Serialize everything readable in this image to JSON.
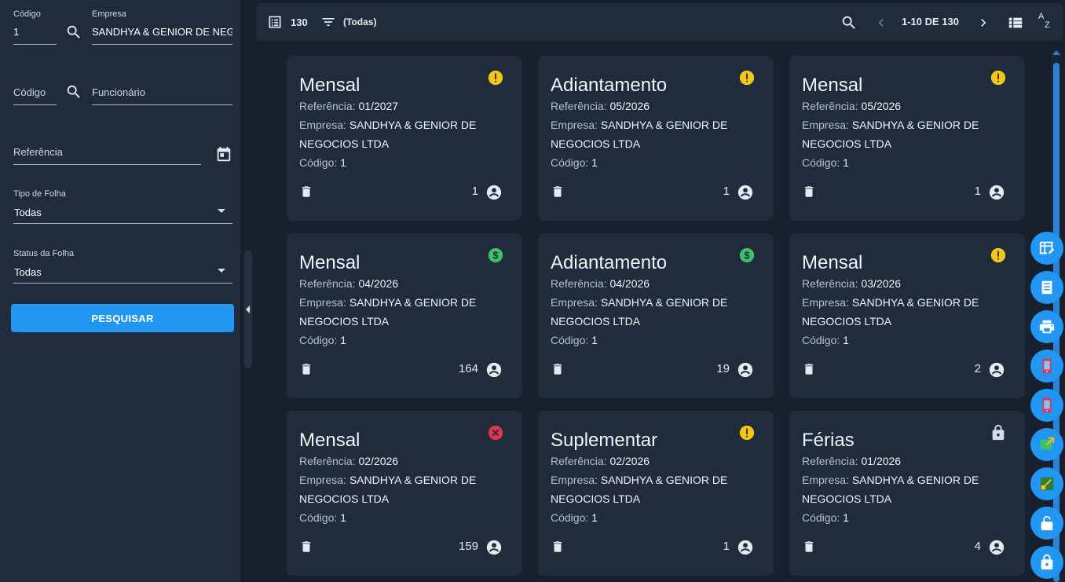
{
  "filters": {
    "codigo_label": "Código",
    "codigo_value": "1",
    "empresa_label": "Empresa",
    "empresa_value": "SANDHYA & GENIOR DE NEGO",
    "func_codigo_placeholder": "Código",
    "funcionario_placeholder": "Funcionário",
    "referencia_placeholder": "Referência",
    "tipo_label": "Tipo de Folha",
    "tipo_value": "Todas",
    "status_label": "Status da Folha",
    "status_value": "Todas",
    "search_button": "PESQUISAR"
  },
  "toolbar": {
    "count": "130",
    "filter_label": "(Todas)",
    "pagination": "1-10 DE 130"
  },
  "labels": {
    "referencia": "Referência:",
    "empresa": "Empresa:",
    "codigo": "Código:"
  },
  "cards": [
    {
      "title": "Mensal",
      "referencia": "01/2027",
      "empresa_l1": "SANDHYA & GENIOR DE",
      "empresa_l2": "NEGOCIOS LTDA",
      "codigo": "1",
      "count": "1",
      "status": "warning-icon"
    },
    {
      "title": "Adiantamento",
      "referencia": "05/2026",
      "empresa_l1": "SANDHYA & GENIOR DE",
      "empresa_l2": "NEGOCIOS LTDA",
      "codigo": "1",
      "count": "1",
      "status": "warning-icon"
    },
    {
      "title": "Mensal",
      "referencia": "05/2026",
      "empresa_l1": "SANDHYA & GENIOR DE",
      "empresa_l2": "NEGOCIOS LTDA",
      "codigo": "1",
      "count": "1",
      "status": "warning-icon"
    },
    {
      "title": "Mensal",
      "referencia": "04/2026",
      "empresa_l1": "SANDHYA & GENIOR DE",
      "empresa_l2": "NEGOCIOS LTDA",
      "codigo": "1",
      "count": "164",
      "status": "paid-icon"
    },
    {
      "title": "Adiantamento",
      "referencia": "04/2026",
      "empresa_l1": "SANDHYA & GENIOR DE",
      "empresa_l2": "NEGOCIOS LTDA",
      "codigo": "1",
      "count": "19",
      "status": "paid-icon"
    },
    {
      "title": "Mensal",
      "referencia": "03/2026",
      "empresa_l1": "SANDHYA & GENIOR DE",
      "empresa_l2": "NEGOCIOS LTDA",
      "codigo": "1",
      "count": "2",
      "status": "warning-icon"
    },
    {
      "title": "Mensal",
      "referencia": "02/2026",
      "empresa_l1": "SANDHYA & GENIOR DE",
      "empresa_l2": "NEGOCIOS LTDA",
      "codigo": "1",
      "count": "159",
      "status": "error-icon"
    },
    {
      "title": "Suplementar",
      "referencia": "02/2026",
      "empresa_l1": "SANDHYA & GENIOR DE",
      "empresa_l2": "NEGOCIOS LTDA",
      "codigo": "1",
      "count": "1",
      "status": "warning-icon"
    },
    {
      "title": "Férias",
      "referencia": "01/2026",
      "empresa_l1": "SANDHYA & GENIOR DE",
      "empresa_l2": "NEGOCIOS LTDA",
      "codigo": "1",
      "count": "4",
      "status": "lock-icon"
    }
  ],
  "fabs": [
    "table-edit-icon",
    "document-list-icon",
    "print-icon",
    "mobile-app-icon",
    "mobile-app-icon",
    "export-icon",
    "import-icon",
    "unlock-icon",
    "lock-icon"
  ],
  "colors": {
    "accent": "#2196f3",
    "warning": "#f5c518",
    "paid": "#3fc16b",
    "error": "#e0364f",
    "card_bg": "#202b3b",
    "page_bg": "#17202c"
  }
}
